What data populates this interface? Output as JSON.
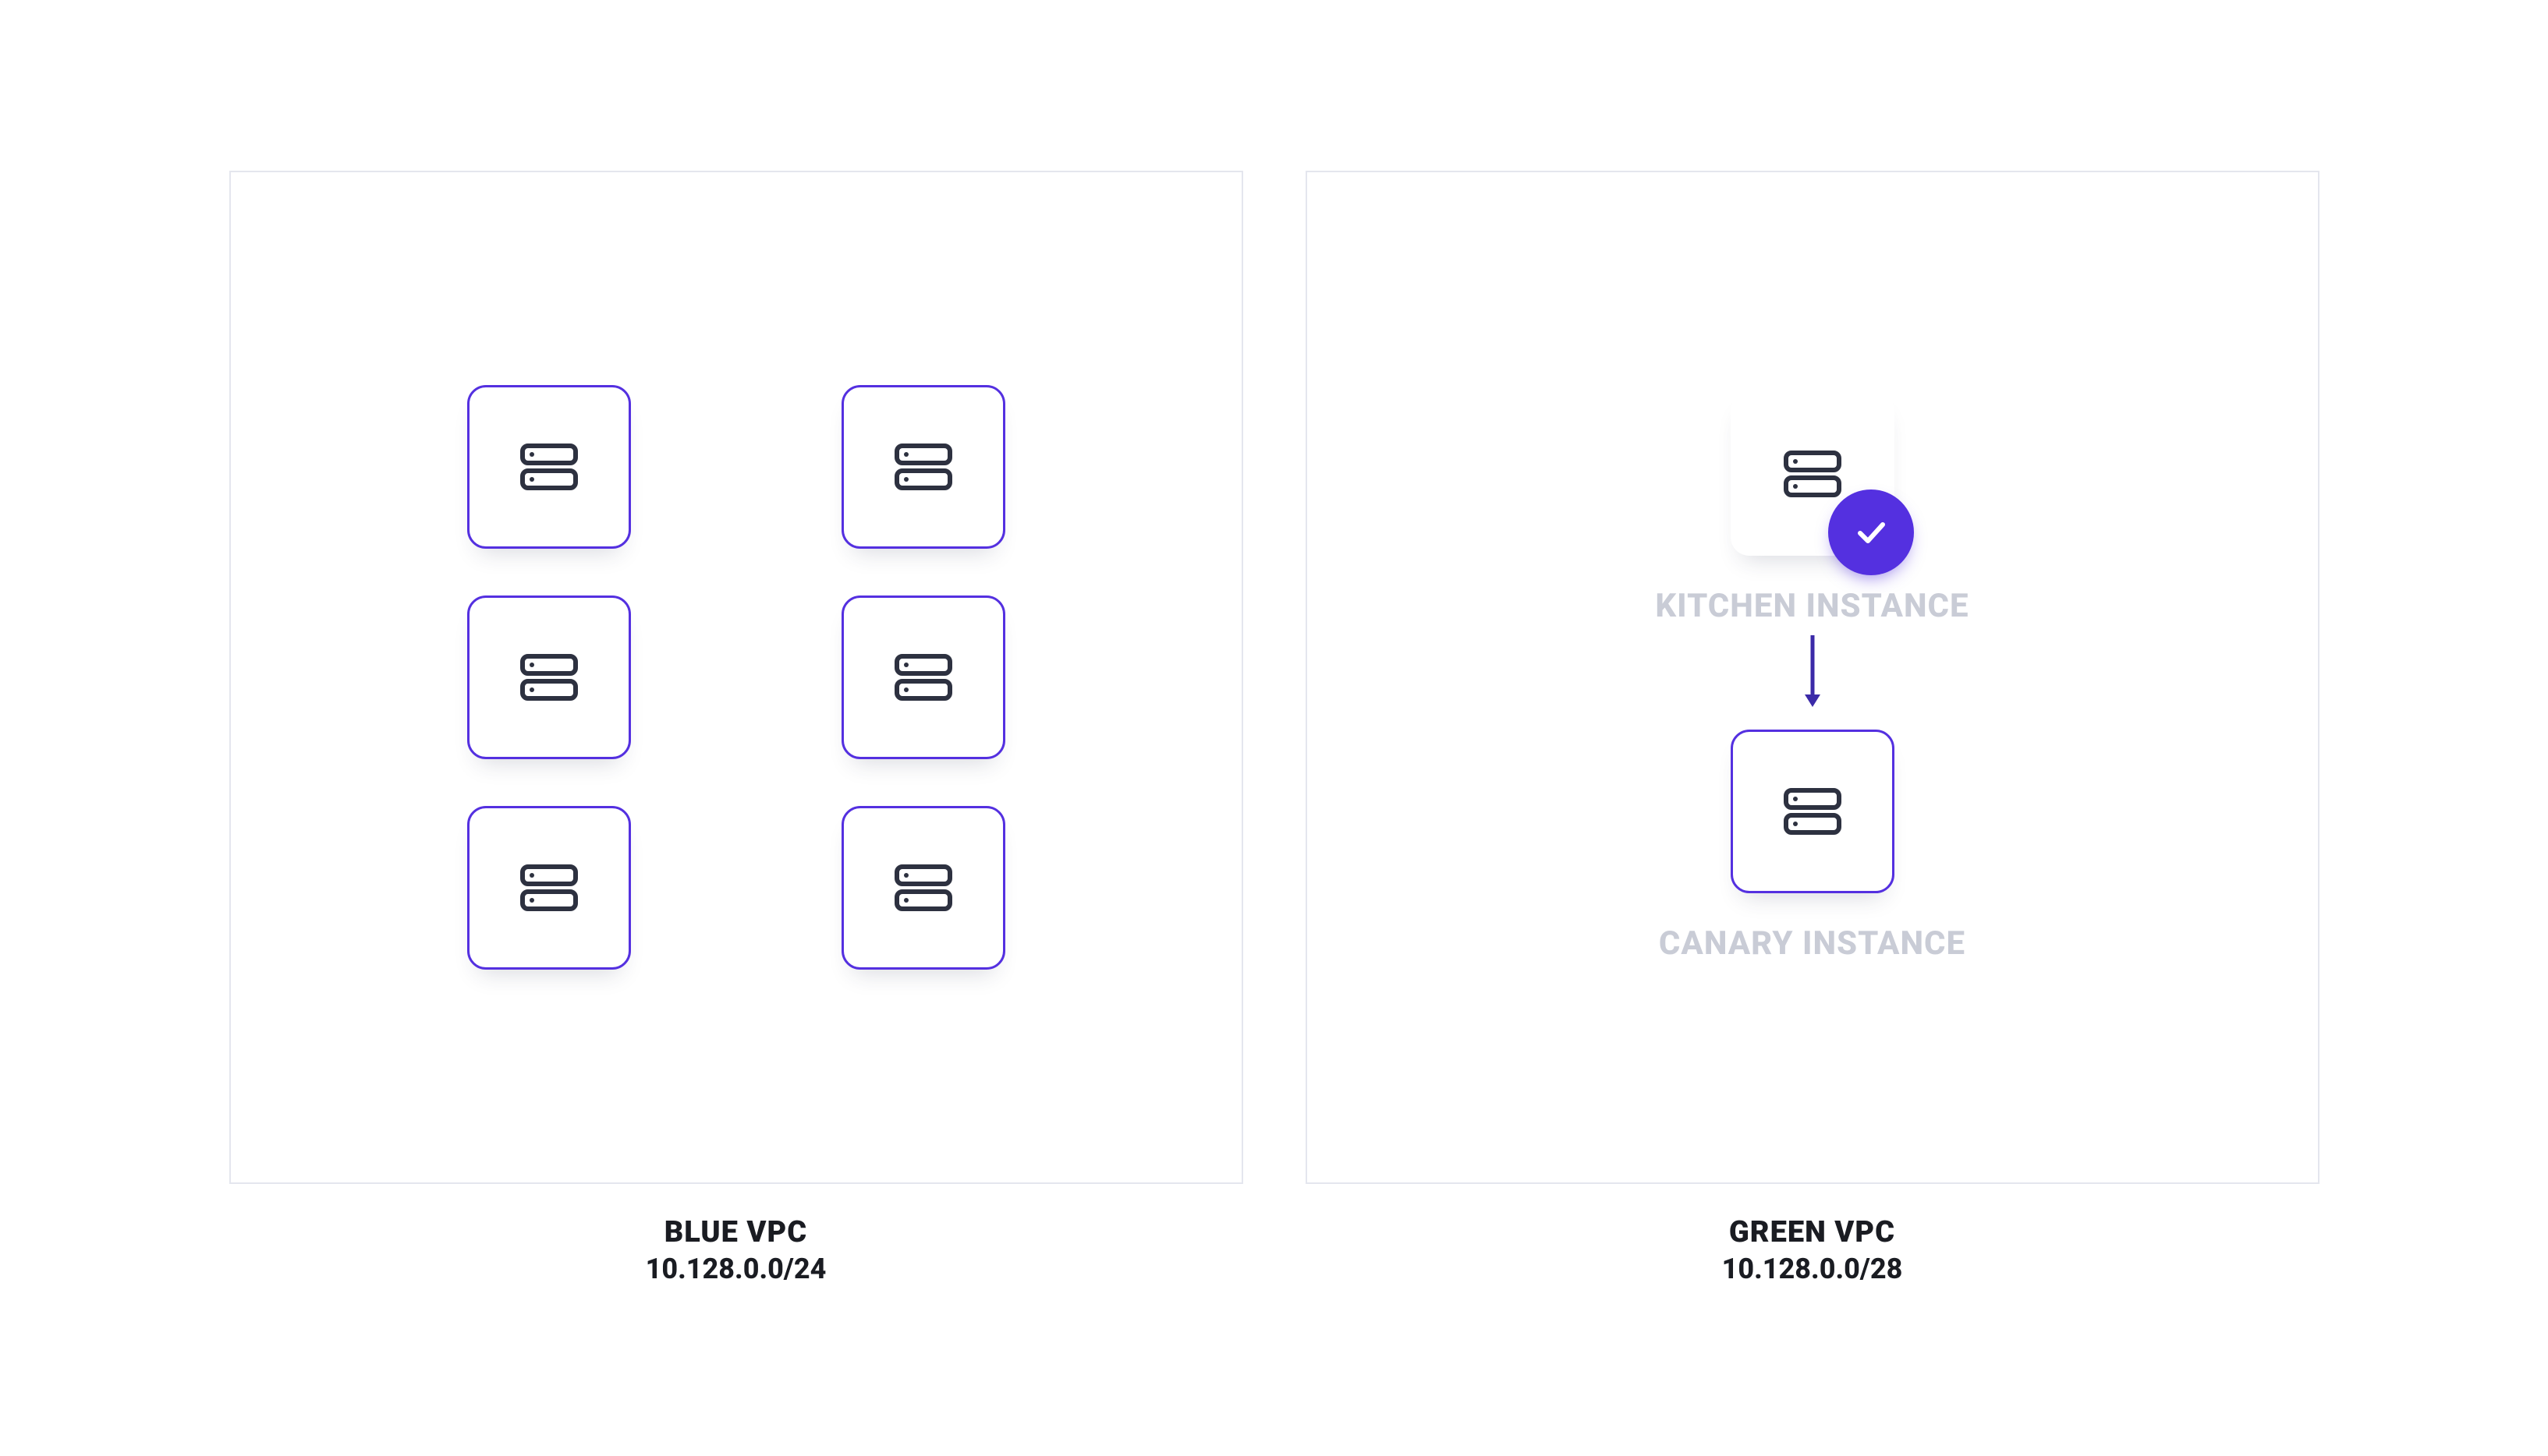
{
  "colors": {
    "accent": "#5430e0",
    "border": "#e4e6ee",
    "icon_stroke": "#2d3140",
    "muted_text": "#c9ccd6",
    "text": "#1a1c22"
  },
  "blue_vpc": {
    "name": "BLUE VPC",
    "cidr": "10.128.0.0/24",
    "server_count": 6
  },
  "green_vpc": {
    "name": "GREEN VPC",
    "cidr": "10.128.0.0/28",
    "kitchen_label": "KITCHEN INSTANCE",
    "canary_label": "CANARY INSTANCE"
  }
}
